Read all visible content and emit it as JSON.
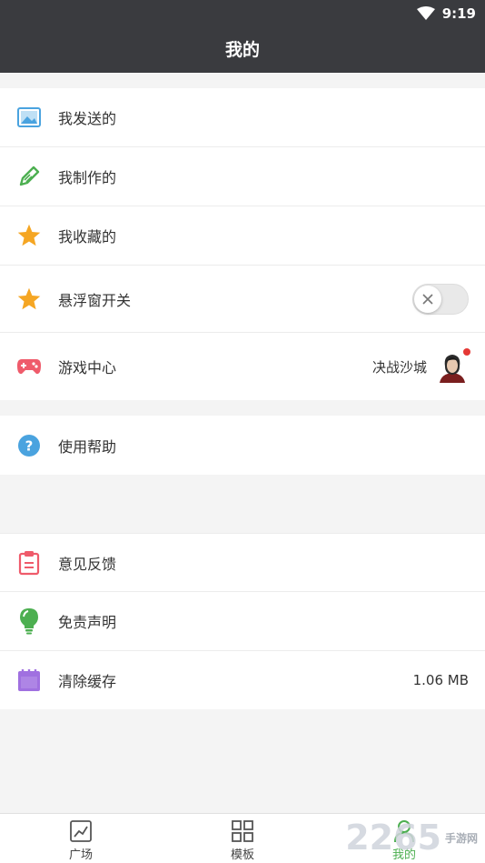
{
  "status_bar": {
    "time": "9:19"
  },
  "header": {
    "title": "我的"
  },
  "group1": {
    "items": [
      {
        "label": "我发送的"
      },
      {
        "label": "我制作的"
      },
      {
        "label": "我收藏的"
      },
      {
        "label": "悬浮窗开关",
        "toggle_on": false
      },
      {
        "label": "游戏中心",
        "right_text": "决战沙城"
      }
    ]
  },
  "group2": {
    "items": [
      {
        "label": "使用帮助"
      }
    ]
  },
  "group3": {
    "items": [
      {
        "label": "意见反馈"
      },
      {
        "label": "免责声明"
      },
      {
        "label": "清除缓存",
        "right_text": "1.06 MB"
      }
    ]
  },
  "tabbar": {
    "tabs": [
      {
        "label": "广场",
        "icon": "chart-image-icon"
      },
      {
        "label": "模板",
        "icon": "grid-icon"
      },
      {
        "label": "我的",
        "icon": "person-icon",
        "active": true
      }
    ]
  },
  "watermark": {
    "number": "2265",
    "text": "手游网"
  },
  "colors": {
    "header_bg": "#3a3b3f",
    "active_tab": "#4caf50",
    "star": "#f5a623",
    "image_icon": "#4aa3df",
    "pencil_icon": "#4caf50",
    "game_icon": "#ef5b6b",
    "help_icon": "#4aa3df",
    "feedback_icon": "#ef5b6b",
    "bulb_icon": "#4caf50",
    "calendar_icon": "#a070e0"
  }
}
